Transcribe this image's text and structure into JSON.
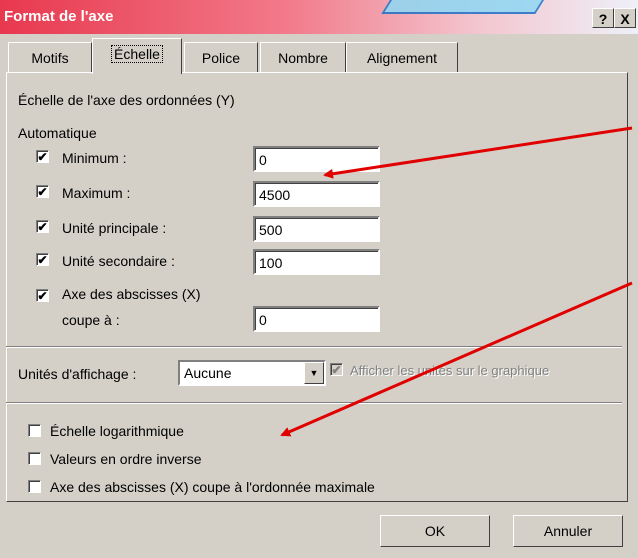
{
  "window": {
    "title": "Format de l'axe",
    "help_label": "?",
    "close_label": "X"
  },
  "tabs": [
    {
      "label": "Motifs",
      "active": false
    },
    {
      "label": "Échelle",
      "active": true
    },
    {
      "label": "Police",
      "active": false
    },
    {
      "label": "Nombre",
      "active": false
    },
    {
      "label": "Alignement",
      "active": false
    }
  ],
  "scale": {
    "heading": "Échelle de l'axe des ordonnées (Y)",
    "auto_label": "Automatique",
    "rows": [
      {
        "label": "Minimum :",
        "checked": true,
        "value": "0"
      },
      {
        "label": "Maximum :",
        "checked": true,
        "value": "4500"
      },
      {
        "label": "Unité principale :",
        "checked": true,
        "value": "500"
      },
      {
        "label": "Unité secondaire :",
        "checked": true,
        "value": "100"
      }
    ],
    "cross": {
      "label_line1": "Axe des abscisses (X)",
      "label_line2": "coupe à :",
      "checked": true,
      "value": "0"
    }
  },
  "display_units": {
    "label": "Unités d'affichage :",
    "value": "Aucune",
    "show_label": "Afficher les unités sur le graphique",
    "show_checked": true
  },
  "options": [
    {
      "label": "Échelle logarithmique",
      "checked": false
    },
    {
      "label": "Valeurs en ordre inverse",
      "checked": false
    },
    {
      "label": "Axe des abscisses (X) coupe à l'ordonnée maximale",
      "checked": false
    }
  ],
  "buttons": {
    "ok": "OK",
    "cancel": "Annuler"
  },
  "colors": {
    "arrow": "#e00000",
    "title_start": "#e8384e"
  }
}
